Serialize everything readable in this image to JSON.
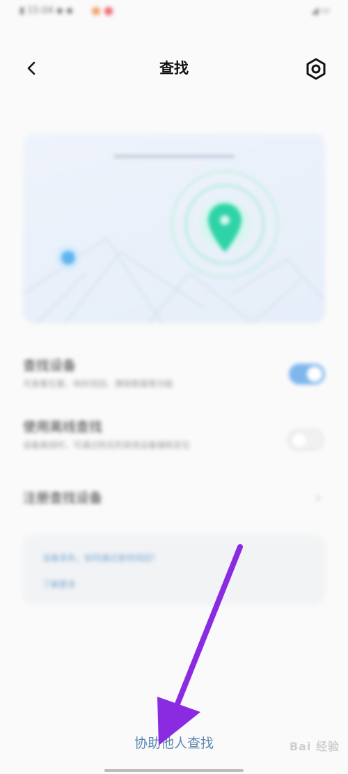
{
  "header": {
    "title": "查找",
    "back_icon": "chevron-left-icon",
    "settings_icon": "gear-icon"
  },
  "rows": [
    {
      "title": "查找设备",
      "subtitle": "可查看位置、响铃找回、擦除数据等功能",
      "toggle": true
    },
    {
      "title": "使用离线查找",
      "subtitle": "设备离线时，可通过附近的其他设备辅助定位",
      "toggle": false
    },
    {
      "title": "注册查找设备",
      "subtitle": "",
      "toggle": null
    }
  ],
  "info_card": {
    "line1": "设备丢失，如何通过查找找回？",
    "line2": "了解更多"
  },
  "footer": {
    "help_link": "协助他人查找"
  },
  "watermark": {
    "text": "Bai 经验"
  },
  "colors": {
    "accent": "#5c88b1",
    "arrow": "#8a2be2",
    "pin": "#2ed3a8"
  }
}
